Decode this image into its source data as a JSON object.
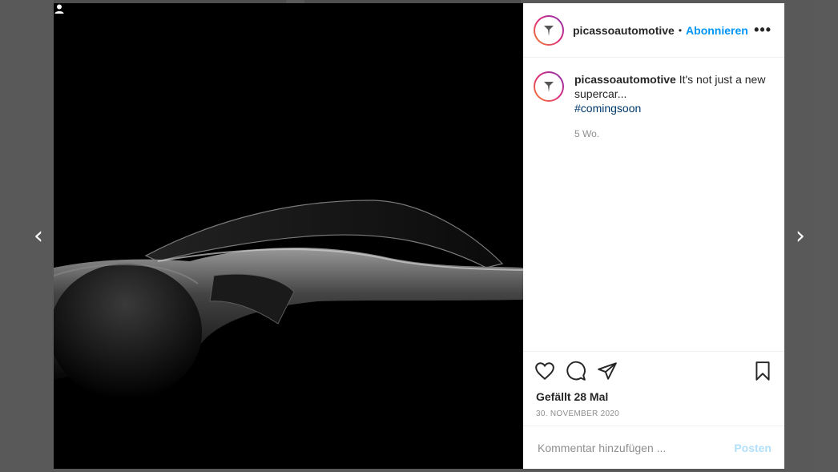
{
  "nav": {
    "prev_icon": "chevron-left-icon",
    "next_icon": "chevron-right-icon",
    "prev_glyph": "‹",
    "next_glyph": "›"
  },
  "post": {
    "username": "picassoautomotive",
    "follow_label": "Abonnieren",
    "separator": "•",
    "more_glyph": "•••",
    "caption_text": "It's not just a new supercar...",
    "hashtag": "#comingsoon",
    "time_ago": "5 Wo.",
    "likes_text": "Gefällt 28 Mal",
    "date_text": "30. NOVEMBER 2020"
  },
  "comment": {
    "placeholder": "Kommentar hinzufügen ...",
    "post_label": "Posten"
  },
  "colors": {
    "accent": "#0095f6",
    "hashtag": "#00376b",
    "post_disabled": "#b2dffc"
  }
}
